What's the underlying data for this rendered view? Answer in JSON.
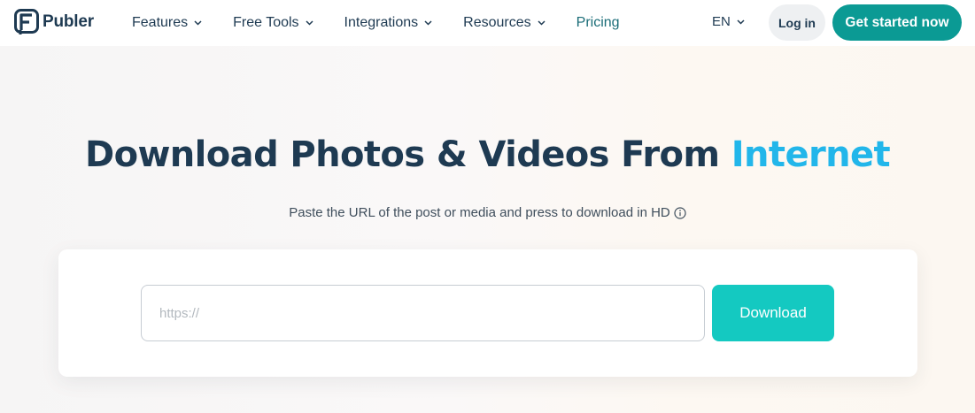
{
  "brand": {
    "name": "Publer"
  },
  "nav": {
    "features": "Features",
    "free_tools": "Free Tools",
    "integrations": "Integrations",
    "resources": "Resources",
    "pricing": "Pricing",
    "language": "EN",
    "login": "Log in",
    "cta": "Get started now"
  },
  "hero": {
    "title_main": "Download Photos & Videos From ",
    "title_accent": "Internet",
    "subtitle": "Paste the URL of the post or media and press to download in HD"
  },
  "download": {
    "placeholder": "https://",
    "value": "",
    "button": "Download"
  },
  "icons": {
    "logo": "publer-logo-icon",
    "dropdown": "chevron-down-icon",
    "info": "info-icon"
  },
  "colors": {
    "brand_teal": "#0b9a94",
    "download_button": "#14c9c1",
    "title_accent": "#22b6ea",
    "text_dark": "#1e3a52"
  }
}
